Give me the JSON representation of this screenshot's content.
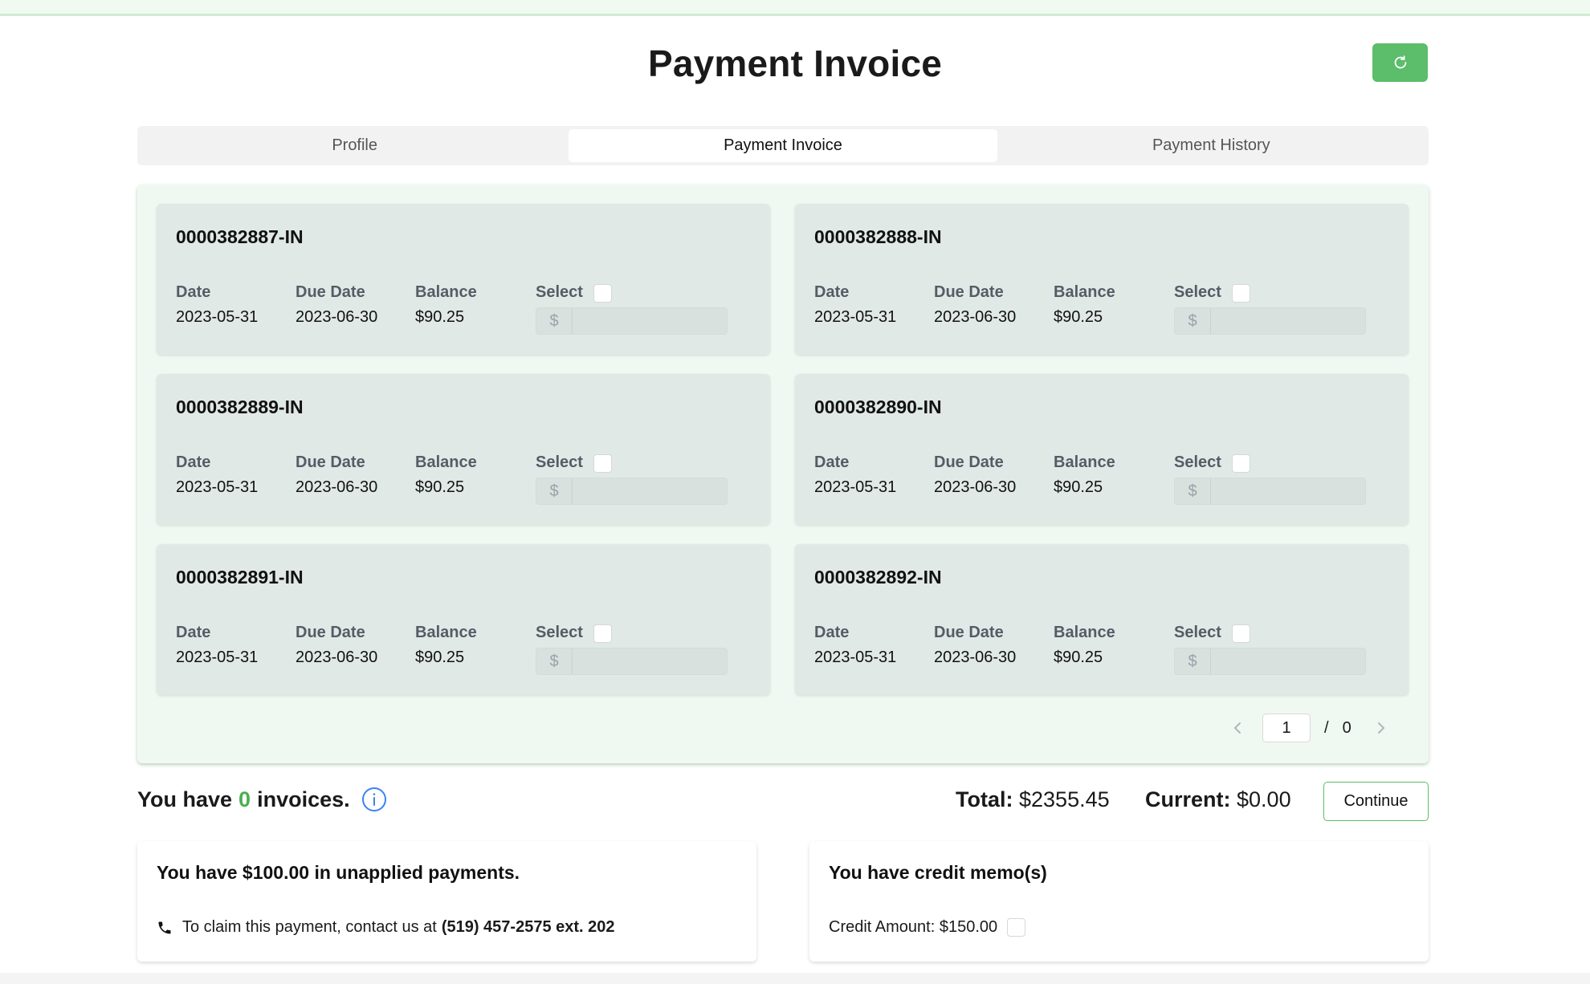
{
  "page": {
    "title": "Payment Invoice"
  },
  "colors": {
    "accent": "#5cbd6b",
    "panel_bg": "#f0f9f1",
    "card_bg": "#e1e9e6",
    "info_blue": "#3b82f6"
  },
  "header": {
    "refresh_icon": "refresh-icon"
  },
  "tabs": [
    {
      "label": "Profile",
      "active": false
    },
    {
      "label": "Payment Invoice",
      "active": true
    },
    {
      "label": "Payment History",
      "active": false
    }
  ],
  "invoice_fields": {
    "date_label": "Date",
    "due_date_label": "Due Date",
    "balance_label": "Balance",
    "select_label": "Select",
    "currency_prefix": "$"
  },
  "invoices": [
    {
      "id": "0000382887-IN",
      "date": "2023-05-31",
      "due_date": "2023-06-30",
      "balance": "$90.25",
      "selected": false,
      "amount": ""
    },
    {
      "id": "0000382888-IN",
      "date": "2023-05-31",
      "due_date": "2023-06-30",
      "balance": "$90.25",
      "selected": false,
      "amount": ""
    },
    {
      "id": "0000382889-IN",
      "date": "2023-05-31",
      "due_date": "2023-06-30",
      "balance": "$90.25",
      "selected": false,
      "amount": ""
    },
    {
      "id": "0000382890-IN",
      "date": "2023-05-31",
      "due_date": "2023-06-30",
      "balance": "$90.25",
      "selected": false,
      "amount": ""
    },
    {
      "id": "0000382891-IN",
      "date": "2023-05-31",
      "due_date": "2023-06-30",
      "balance": "$90.25",
      "selected": false,
      "amount": ""
    },
    {
      "id": "0000382892-IN",
      "date": "2023-05-31",
      "due_date": "2023-06-30",
      "balance": "$90.25",
      "selected": false,
      "amount": ""
    }
  ],
  "pagination": {
    "current_page": "1",
    "separator": "/",
    "total_pages": "0"
  },
  "summary": {
    "prefix": "You have",
    "invoice_count": "0",
    "suffix": "invoices.",
    "total_label": "Total:",
    "total_value": "$2355.45",
    "current_label": "Current:",
    "current_value": "$0.00",
    "continue_label": "Continue"
  },
  "unapplied": {
    "title": "You have $100.00 in unapplied payments.",
    "contact_text": "To claim this payment, contact us at",
    "phone": "(519) 457-2575 ext. 202"
  },
  "credit": {
    "title": "You have credit memo(s)",
    "amount_text": "Credit Amount: $150.00",
    "checked": false
  }
}
